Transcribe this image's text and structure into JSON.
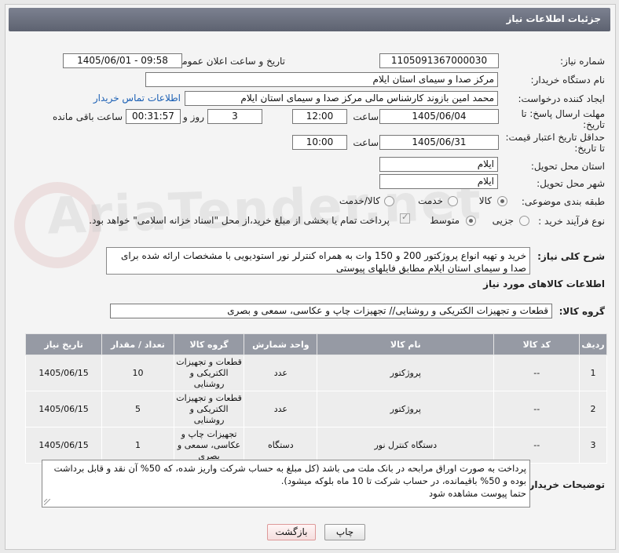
{
  "title": "جزئیات اطلاعات نیاز",
  "watermark": "AriaTender.net",
  "fields": {
    "need_number_label": "شماره نیاز:",
    "need_number": "1105091367000030",
    "announce_label": "تاریخ و ساعت اعلان عمومی:",
    "announce_value": "1405/06/01 - 09:58",
    "buyer_label": "نام دستگاه خریدار:",
    "buyer": "مرکز صدا و سیمای استان ایلام",
    "creator_label": "ایجاد کننده درخواست:",
    "creator": "محمد امین بازوند کارشناس مالی مرکز صدا و سیمای استان ایلام",
    "contact_link": "اطلاعات تماس خریدار",
    "deadline_label_1": "مهلت ارسال پاسخ: تا",
    "deadline_label_2": "تاریخ:",
    "deadline_date": "1405/06/04",
    "time_label": "ساعت",
    "deadline_time": "12:00",
    "days": "3",
    "days_label": "روز و",
    "remaining": "00:31:57",
    "remaining_label": "ساعت باقی مانده",
    "validity_label_1": "حداقل تاریخ اعتبار قیمت:",
    "validity_label_2": "تا تاریخ:",
    "validity_date": "1405/06/31",
    "validity_time": "10:00",
    "province_label": "استان محل تحویل:",
    "province": "ایلام",
    "city_label": "شهر محل تحویل:",
    "city": "ایلام",
    "category_label": "طبقه بندی موضوعی:",
    "category_options": [
      "کالا",
      "خدمت",
      "کالا/خدمت"
    ],
    "category_selected": "کالا",
    "process_label": "نوع فرآیند خرید :",
    "process_options": [
      "جزیی",
      "متوسط"
    ],
    "process_selected": "جزیی",
    "payment_note": "پرداخت تمام یا بخشی از مبلغ خرید،از محل \"اسناد خزانه اسلامی\" خواهد بود."
  },
  "summary": {
    "label": "شرح کلی نیاز:",
    "text": "خرید و تهیه انواع پروژکتور 200 و 150 وات به همراه کنترلر نور استودیویی با مشخصات ارائه شده برای صدا و سیمای استان ایلام مطابق فایلهای پیوستی"
  },
  "goods_info_label": "اطلاعات کالاهای مورد نیاز",
  "goods_group_label": "گروه کالا:",
  "goods_group": "قطعات و تجهیزات الکتریکی و روشنایی// تجهیزات چاپ و عکاسی، سمعی و بصری",
  "table": {
    "headers": [
      "ردیف",
      "کد کالا",
      "نام کالا",
      "واحد شمارش",
      "گروه کالا",
      "تعداد / مقدار",
      "تاریخ نیاز"
    ],
    "rows": [
      {
        "idx": "1",
        "code": "--",
        "name": "پروژکتور",
        "unit": "عدد",
        "group": "قطعات و تجهیزات الکتریکی و روشنایی",
        "qty": "10",
        "date": "1405/06/15"
      },
      {
        "idx": "2",
        "code": "--",
        "name": "پروژکتور",
        "unit": "عدد",
        "group": "قطعات و تجهیزات الکتریکی و روشنایی",
        "qty": "5",
        "date": "1405/06/15"
      },
      {
        "idx": "3",
        "code": "--",
        "name": "دستگاه کنترل نور",
        "unit": "دستگاه",
        "group": "تجهیزات چاپ و عکاسی، سمعی و بصری",
        "qty": "1",
        "date": "1405/06/15"
      }
    ]
  },
  "buyer_notes": {
    "label": "توضیحات خریدار:",
    "line1": "پرداخت به صورت اوراق مرابحه در بانک ملت می باشد (کل مبلغ به حساب شرکت واریز شده، که 50% آن نقد و قابل برداشت",
    "line2": "بوده و 50%  باقیمانده، در حساب شرکت تا 10 ماه بلوکه میشود).",
    "line3": "حتما پیوست مشاهده شود"
  },
  "buttons": {
    "print": "چاپ",
    "back": "بازگشت"
  }
}
